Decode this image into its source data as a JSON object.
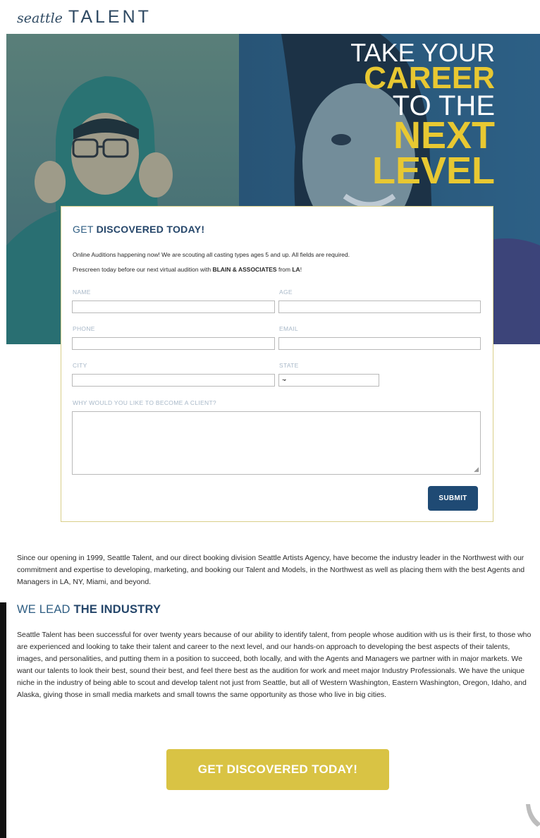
{
  "brand": {
    "logo_script": "seattle",
    "logo_word": "TALENT"
  },
  "hero": {
    "line1": "TAKE YOUR",
    "line2": "CAREER",
    "line3": "TO THE",
    "line4": "NEXT",
    "line5": "LEVEL"
  },
  "form": {
    "title_light": "GET ",
    "title_bold": "DISCOVERED TODAY!",
    "intro_line1": "Online Auditions happening now! We are scouting all casting types ages 5 and up. All fields are required.",
    "intro_line2_pre": "Prescreen today before our next virtual audition with ",
    "intro_line2_bold1": "BLAIN & ASSOCIATES",
    "intro_line2_mid": " from ",
    "intro_line2_bold2": "LA",
    "intro_line2_end": "!",
    "fields": {
      "name_label": "NAME",
      "age_label": "AGE",
      "phone_label": "PHONE",
      "email_label": "EMAIL",
      "city_label": "CITY",
      "state_label": "STATE",
      "state_value": "--",
      "why_label": "WHY WOULD YOU LIKE TO BECOME A CLIENT?"
    },
    "submit_label": "SUBMIT"
  },
  "about_text": "Since our opening in 1999, Seattle Talent, and our direct booking division Seattle Artists Agency, have become the industry leader in the Northwest with our commitment and expertise to developing, marketing, and booking our Talent and Models, in the Northwest as well as placing them with the best Agents and Managers in LA, NY, Miami, and beyond.",
  "lead": {
    "heading_light": "WE LEAD ",
    "heading_bold": "THE INDUSTRY",
    "text": "Seattle Talent has been successful for over twenty years because of our ability to identify talent, from people whose audition with us is their first, to those who are experienced and looking to take their talent and career to the next level, and our hands-on approach to developing the best aspects of their talents, images, and personalities, and putting them in a position to succeed, both locally, and with the Agents and Managers we partner with in major markets. We want our talents to look their best, sound their best, and feel there best as the audition for work and meet major Industry Professionals. We have the unique niche in the industry of being able to scout and develop talent not just from Seattle, but all of Western Washington, Eastern Washington, Oregon, Idaho, and Alaska, giving those in small media markets and small towns the same opportunity as those who live in big cities."
  },
  "cta_label": "GET DISCOVERED TODAY!",
  "colors": {
    "navy": "#1f4a74",
    "gold": "#d9c344",
    "hero_yellow": "#e8c832"
  }
}
